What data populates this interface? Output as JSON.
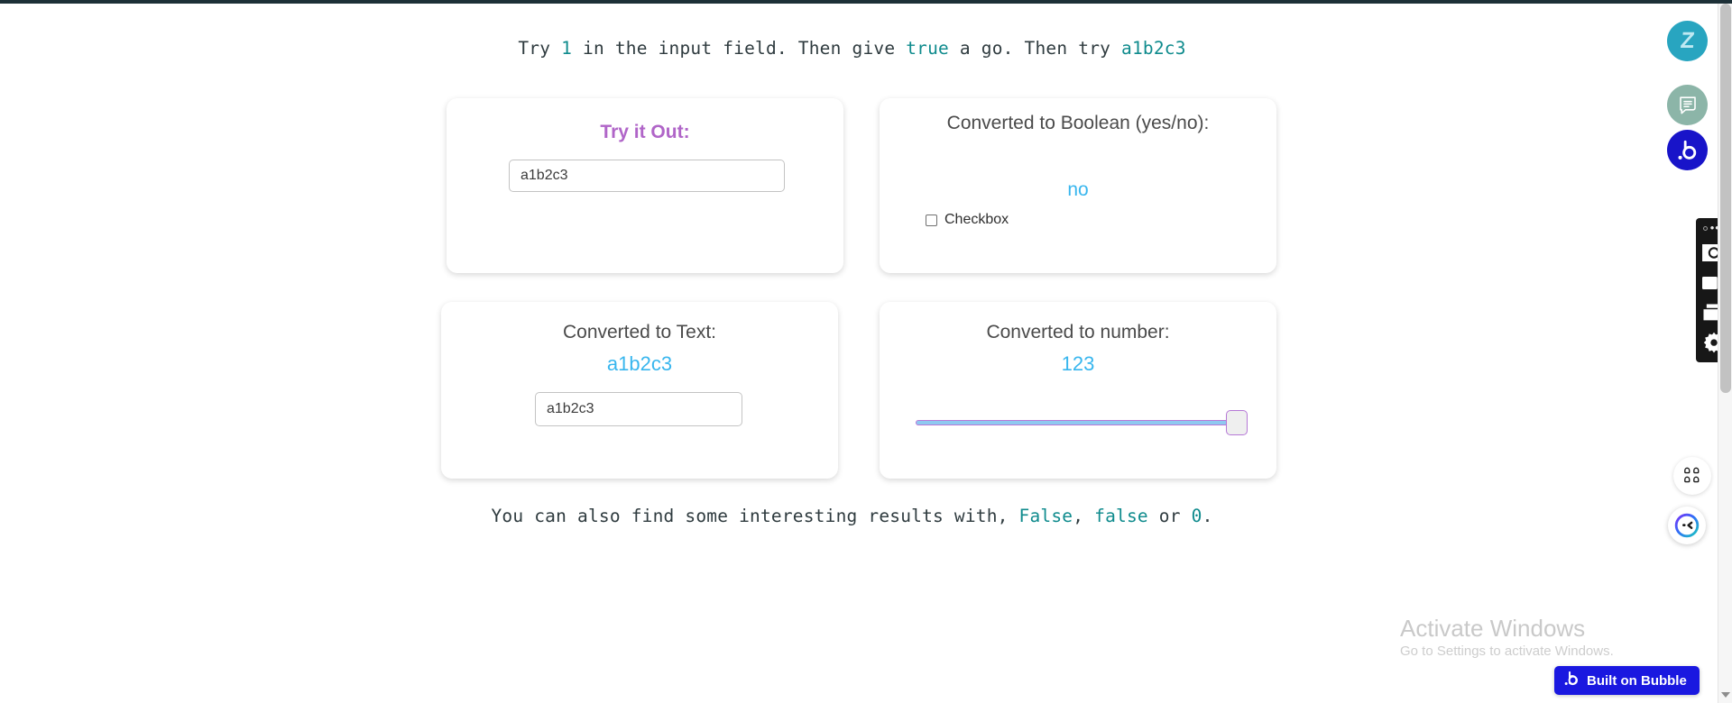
{
  "headline": {
    "parts": [
      {
        "text": "Try ",
        "highlight": false
      },
      {
        "text": "1",
        "highlight": true
      },
      {
        "text": " in the input field. Then give ",
        "highlight": false
      },
      {
        "text": "true",
        "highlight": true
      },
      {
        "text": " a go. Then try ",
        "highlight": false
      },
      {
        "text": "a1b2c3",
        "highlight": true
      }
    ],
    "plain": "Try 1 in the input field. Then give true a go. Then try a1b2c3"
  },
  "footline": {
    "parts": [
      {
        "text": "You can also find some interesting results with, ",
        "highlight": false
      },
      {
        "text": "False",
        "highlight": true
      },
      {
        "text": ", ",
        "highlight": false
      },
      {
        "text": "false",
        "highlight": true
      },
      {
        "text": " or ",
        "highlight": false
      },
      {
        "text": "0",
        "highlight": true
      },
      {
        "text": ".",
        "highlight": false
      }
    ],
    "plain": "You can also find some interesting results with, False, false or 0."
  },
  "cards": {
    "try_it_out": {
      "title": "Try it Out:",
      "input_value": "a1b2c3",
      "input_placeholder": ""
    },
    "boolean": {
      "title": "Converted to Boolean (yes/no):",
      "value": "no",
      "checkbox_label": "Checkbox",
      "checkbox_checked": false
    },
    "text": {
      "title": "Converted to Text:",
      "value": "a1b2c3",
      "input_value": "a1b2c3",
      "input_placeholder": ""
    },
    "number": {
      "title": "Converted to number:",
      "value": "123",
      "slider_percent": 100
    }
  },
  "right_rail": {
    "zoho_label": "Z",
    "doc_label": "document",
    "bubble_label": "b"
  },
  "capture_toolbar": {
    "menu_label": "•••",
    "items": [
      "camera-icon",
      "video-icon",
      "window-icon",
      "gear-icon"
    ]
  },
  "float_buttons": {
    "apps_label": "apps-grid",
    "chat_label": "chat-assistant"
  },
  "watermark": {
    "title": "Activate Windows",
    "subtitle": "Go to Settings to activate Windows."
  },
  "bubble_badge": {
    "text": "Built on Bubble"
  },
  "colors": {
    "accent_purple": "#b065c8",
    "accent_blue": "#38b6ee",
    "mono_highlight": "#0f8b8d",
    "bubble_blue": "#1a18e0",
    "slider_track": "#8ec9f0",
    "slider_border": "#b678d6"
  }
}
